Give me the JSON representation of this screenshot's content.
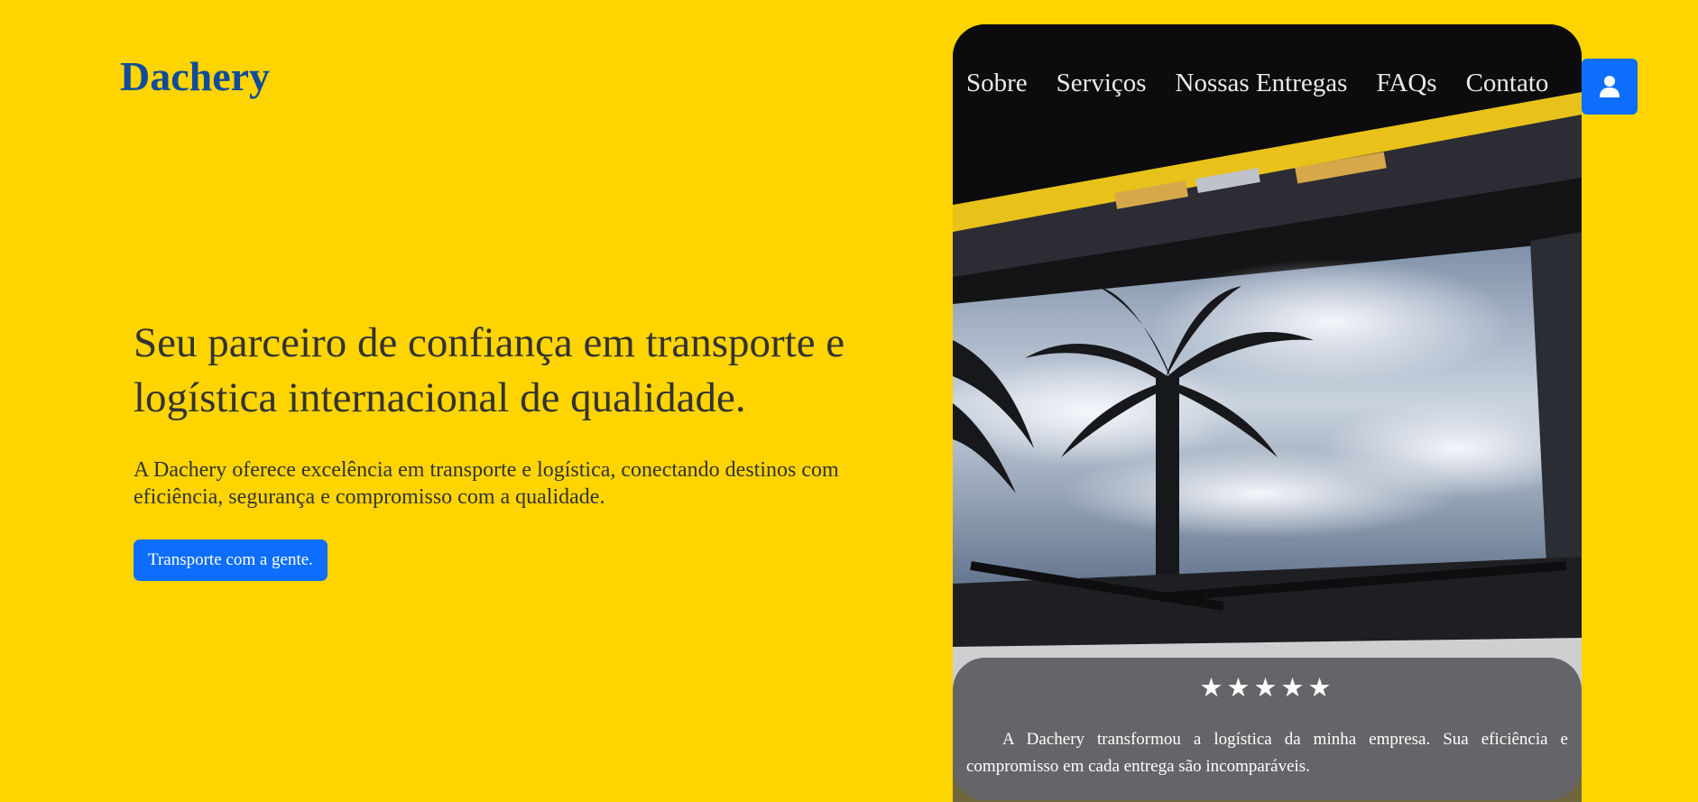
{
  "brand": {
    "name": "Dachery"
  },
  "nav": {
    "items": [
      "Sobre",
      "Serviços",
      "Nossas Entregas",
      "FAQs",
      "Contato"
    ]
  },
  "hero": {
    "title": "Seu parceiro de confiança em transporte e logística internacional de qualidade.",
    "description": "A Dachery oferece excelência em transporte e logística, conectando destinos com eficiência, segurança e compromisso com a qualidade.",
    "cta_label": "Transporte com a gente."
  },
  "review": {
    "rating": 5,
    "stars": "★★★★★",
    "text": "A Dachery transformou a logística da minha empresa. Sua eficiência e compromisso em cada entrega são incomparáveis."
  },
  "colors": {
    "background": "#FFD400",
    "brand": "#0F4C9A",
    "accent": "#0D6EFD"
  },
  "icons": {
    "account": "user-icon"
  }
}
